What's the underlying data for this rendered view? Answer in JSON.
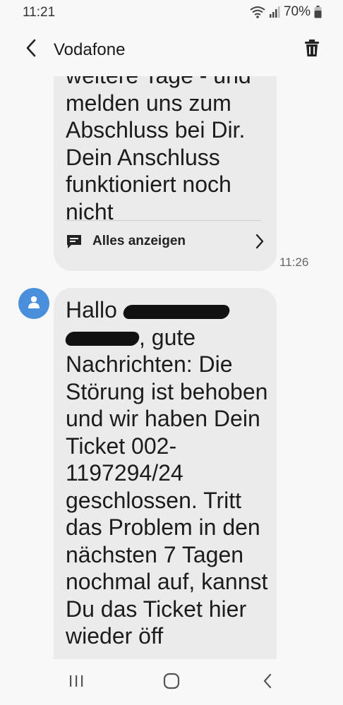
{
  "status_bar": {
    "time": "11:21",
    "battery": "70%"
  },
  "header": {
    "contact_name": "Vodafone"
  },
  "messages": [
    {
      "text": "weitere Tage - und\nmelden uns zum\nAbschluss bei Dir.\nDein Anschluss\nfunktioniert noch\nnicht",
      "show_all_label": "Alles anzeigen",
      "time": "11:26"
    },
    {
      "greeting": "Hallo",
      "after_redaction": ", gute Nachrichten:",
      "body": "Die Störung ist behoben und wir haben Dein Ticket 002-1197294/24 geschlossen. Tritt das Problem in den nächsten 7 Tagen nochmal auf, kannst Du das Ticket hier wieder",
      "cutoff_line": "öff"
    }
  ],
  "colors": {
    "bubble": "#ebebeb",
    "background": "#f8f8f8",
    "avatar": "#4a8fdc"
  }
}
